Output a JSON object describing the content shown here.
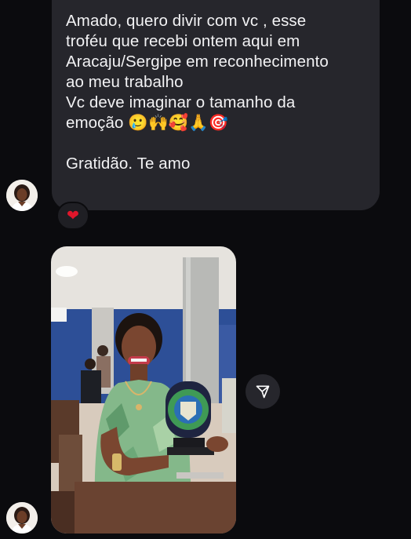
{
  "message": {
    "lines": [
      "Amado, quero divir com vc , esse",
      "troféu que recebi ontem aqui em",
      "Aracaju/Sergipe em reconhecimento",
      "ao meu trabalho",
      "Vc deve imaginar o tamanho da",
      "emoção 🥲🙌🥰🙏🎯"
    ],
    "closing": "Gratidão.  Te amo"
  },
  "reaction": {
    "emoji": "❤"
  },
  "icons": {
    "reaction": "heart-icon",
    "share": "paper-plane-icon",
    "avatar": "profile-photo"
  },
  "colors": {
    "background": "#0b0b0e",
    "bubble": "#26262c",
    "heart": "#e0162b",
    "text": "#f2f2f4"
  }
}
